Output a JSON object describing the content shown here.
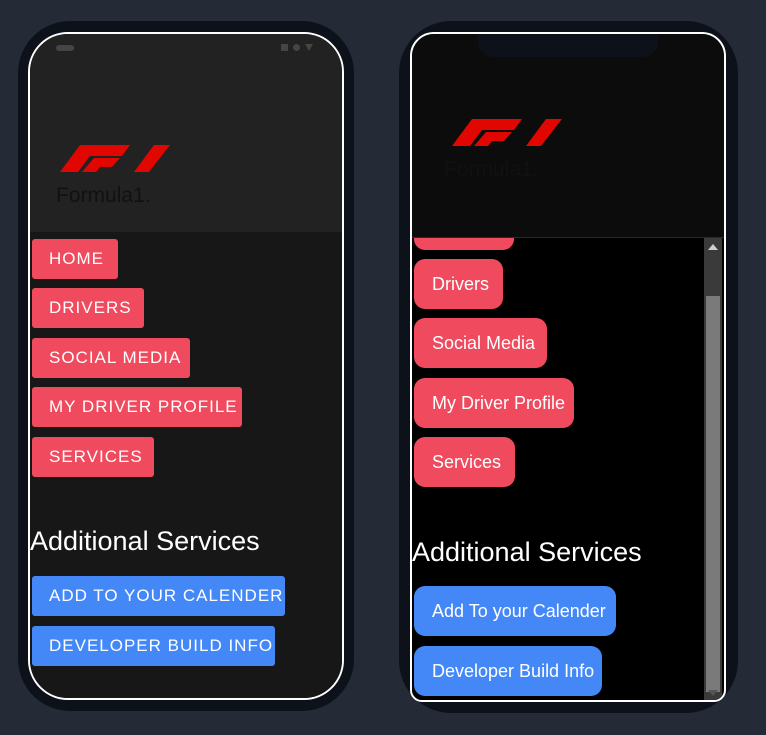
{
  "android": {
    "logo_text": "Formula1.",
    "nav": [
      {
        "label": "HOME"
      },
      {
        "label": "DRIVERS"
      },
      {
        "label": "SOCIAL MEDIA"
      },
      {
        "label": "MY DRIVER PROFILE"
      },
      {
        "label": "SERVICES"
      }
    ],
    "section_title": "Additional Services",
    "services": [
      {
        "label": "ADD TO YOUR CALENDER"
      },
      {
        "label": "DEVELOPER BUILD INFO"
      }
    ]
  },
  "iphone": {
    "logo_text": "Formula1.",
    "nav": [
      {
        "label": "Drivers"
      },
      {
        "label": "Social Media"
      },
      {
        "label": "My Driver Profile"
      },
      {
        "label": "Services"
      }
    ],
    "section_title": "Additional Services",
    "services": [
      {
        "label": "Add To your Calender"
      },
      {
        "label": "Developer Build Info"
      }
    ]
  },
  "colors": {
    "nav_button": "#ef4a5d",
    "service_button": "#4488f8",
    "logo_red": "#e10600"
  }
}
